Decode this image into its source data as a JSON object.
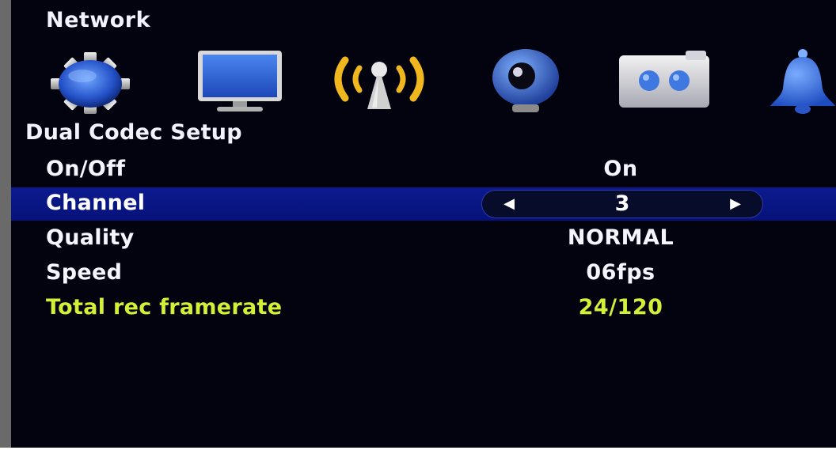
{
  "header": {
    "title": "Network"
  },
  "toolbar": {
    "icons": [
      {
        "name": "system-settings-icon",
        "active": false
      },
      {
        "name": "display-monitor-icon",
        "active": false
      },
      {
        "name": "network-wireless-icon",
        "active": true
      },
      {
        "name": "camera-icon",
        "active": false
      },
      {
        "name": "recording-device-icon",
        "active": false
      },
      {
        "name": "alarm-bell-icon",
        "active": false
      }
    ]
  },
  "section": {
    "title": "Dual Codec Setup"
  },
  "settings": {
    "on_off": {
      "label": "On/Off",
      "value": "On"
    },
    "channel": {
      "label": "Channel",
      "value": "3",
      "prev_glyph": "◀",
      "next_glyph": "▶"
    },
    "quality": {
      "label": "Quality",
      "value": "NORMAL"
    },
    "speed": {
      "label": "Speed",
      "value": "06fps"
    },
    "total_rec_framerate": {
      "label": "Total rec framerate",
      "value": "24/120"
    }
  },
  "colors": {
    "background": "#03030f",
    "selection": "#0b1a8e",
    "info_text": "#d4f036",
    "active_icon": "#f0b81e"
  }
}
